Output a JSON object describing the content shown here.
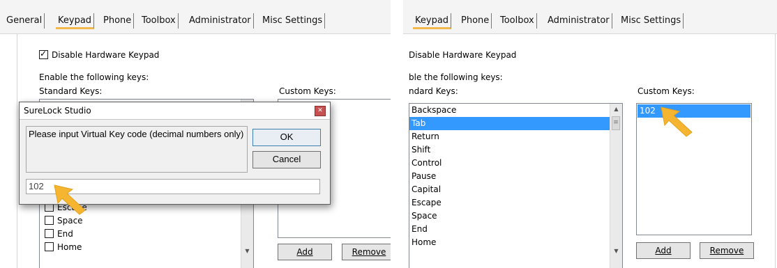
{
  "left": {
    "tabs": [
      "General",
      "Keypad",
      "Phone",
      "Toolbox",
      "Administrator",
      "Misc Settings"
    ],
    "disable_hw_keypad": {
      "label": "Disable Hardware Keypad",
      "checked": true
    },
    "enable_keys_label": "Enable the following keys:",
    "standard_keys_label": "Standard Keys:",
    "custom_keys_label": "Custom Keys:",
    "standard_keys": [
      "Escape",
      "Space",
      "End",
      "Home"
    ],
    "add_label": "Add",
    "remove_label": "Remove",
    "dialog": {
      "title": "SureLock Studio",
      "message": "Please input Virtual Key code (decimal numbers only)",
      "ok_label": "OK",
      "cancel_label": "Cancel",
      "input_value": "102"
    }
  },
  "right": {
    "tabs": [
      "Keypad",
      "Phone",
      "Toolbox",
      "Administrator",
      "Misc Settings"
    ],
    "disable_hw_keypad_label": "Disable Hardware Keypad",
    "enable_keys_label": "ble the following keys:",
    "standard_keys_label": "ndard Keys:",
    "custom_keys_label": "Custom Keys:",
    "standard_keys": [
      "Backspace",
      "Tab",
      "Return",
      "Shift",
      "Control",
      "Pause",
      "Capital",
      "Escape",
      "Space",
      "End",
      "Home"
    ],
    "selected_standard_key": "Tab",
    "custom_keys": [
      "102"
    ],
    "add_label": "Add",
    "remove_label": "Remove"
  },
  "colors": {
    "accent_tab": "#f2b84b",
    "selection": "#3399ff",
    "pointer": "#f5b530"
  }
}
